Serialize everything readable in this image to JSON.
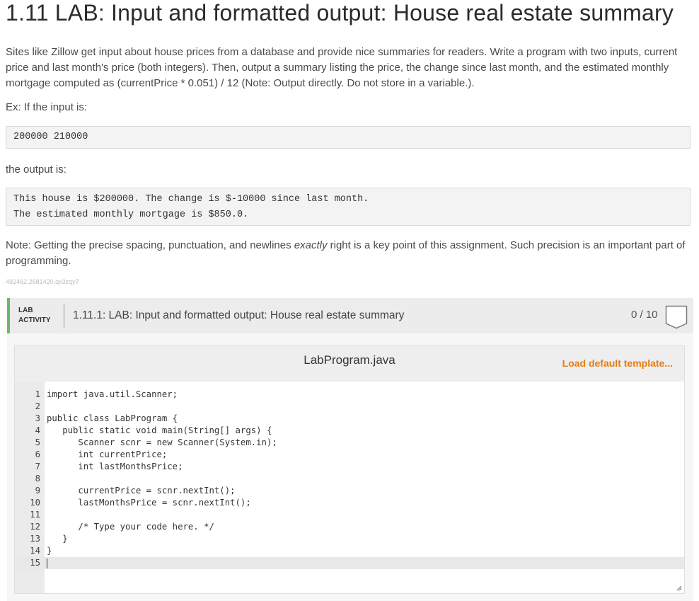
{
  "title": "1.11 LAB: Input and formatted output: House real estate summary",
  "description": "Sites like Zillow get input about house prices from a database and provide nice summaries for readers. Write a program with two inputs, current price and last month's price (both integers). Then, output a summary listing the price, the change since last month, and the estimated monthly mortgage computed as (currentPrice * 0.051) / 12 (Note: Output directly. Do not store in a variable.).",
  "example_intro": "Ex: If the input is:",
  "example_input": "200000 210000",
  "output_intro": "the output is:",
  "example_output": [
    "This house is $200000. The change is $-10000 since last month.",
    "The estimated monthly mortgage is $850.0."
  ],
  "note": {
    "before": "Note: Getting the precise spacing, punctuation, and newlines ",
    "emphasis": "exactly",
    "after": " right is a key point of this assignment. Such precision is an important part of programming."
  },
  "tag_id": "492462.2681420.qx3zqy7",
  "lab": {
    "badge_line1": "LAB",
    "badge_line2": "ACTIVITY",
    "title": "1.11.1: LAB: Input and formatted output: House real estate summary",
    "score": "0 / 10",
    "accent_color": "#6bb86b"
  },
  "editor": {
    "filename": "LabProgram.java",
    "load_template_label": "Load default template...",
    "load_template_color": "#e57c12",
    "lines": [
      "import java.util.Scanner;",
      "",
      "public class LabProgram {",
      "   public static void main(String[] args) {",
      "      Scanner scnr = new Scanner(System.in);",
      "      int currentPrice;",
      "      int lastMonthsPrice;",
      "",
      "      currentPrice = scnr.nextInt();",
      "      lastMonthsPrice = scnr.nextInt();",
      "",
      "      /* Type your code here. */",
      "   }",
      "}",
      ""
    ],
    "line_numbers": [
      "1",
      "2",
      "3",
      "4",
      "5",
      "6",
      "7",
      "8",
      "9",
      "10",
      "11",
      "12",
      "13",
      "14",
      "15"
    ],
    "cursor_line": 15
  }
}
